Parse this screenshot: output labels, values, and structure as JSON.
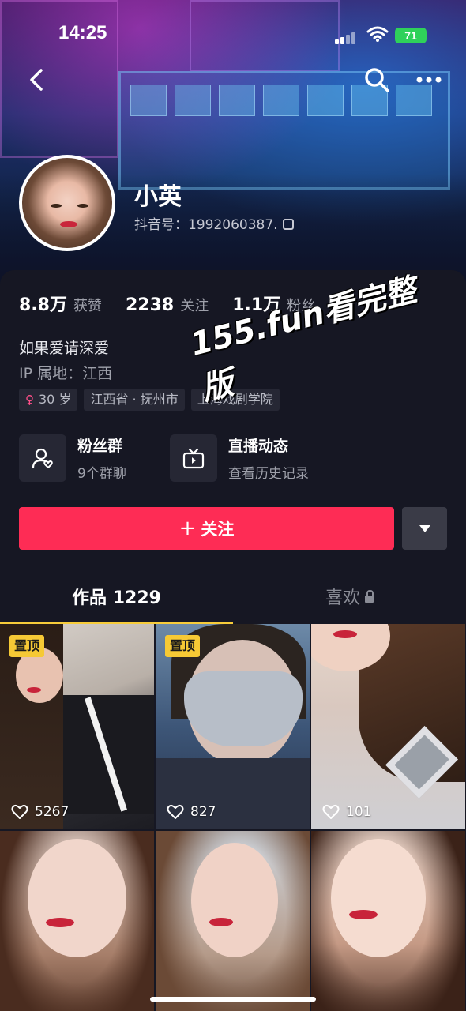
{
  "status_bar": {
    "time": "14:25",
    "battery": "71"
  },
  "profile": {
    "name": "小英",
    "douyin_id": "抖音号：1992060387.",
    "stats": [
      {
        "value": "8.8万",
        "label": "获赞"
      },
      {
        "value": "2238",
        "label": "关注"
      },
      {
        "value": "1.1万",
        "label": "粉丝"
      }
    ],
    "bio": "如果爱请深爱",
    "ip": "IP 属地：江西",
    "tags": [
      {
        "text": "30 岁",
        "icon": "female-icon"
      },
      {
        "text": "江西省 · 抚州市"
      },
      {
        "text": "上海戏剧学院"
      }
    ],
    "watermark": "155.fun看完整版"
  },
  "features": [
    {
      "title": "粉丝群",
      "subtitle": "9个群聊",
      "icon": "fan-group-icon"
    },
    {
      "title": "直播动态",
      "subtitle": "查看历史记录",
      "icon": "live-tv-icon"
    }
  ],
  "actions": {
    "follow": "关注"
  },
  "tabs": {
    "works": "作品 1229",
    "likes": "喜欢"
  },
  "videos": [
    {
      "pinned": "置顶",
      "likes": "5267"
    },
    {
      "pinned": "置顶",
      "likes": "827"
    },
    {
      "pinned": "",
      "likes": "101"
    },
    {
      "pinned": "",
      "likes": ""
    },
    {
      "pinned": "",
      "likes": ""
    },
    {
      "pinned": "",
      "likes": ""
    }
  ],
  "colors": {
    "accent": "#fe2c55",
    "pinned_badge": "#f6c935",
    "tab_underline": "#f7cc3a",
    "background": "#161723"
  }
}
